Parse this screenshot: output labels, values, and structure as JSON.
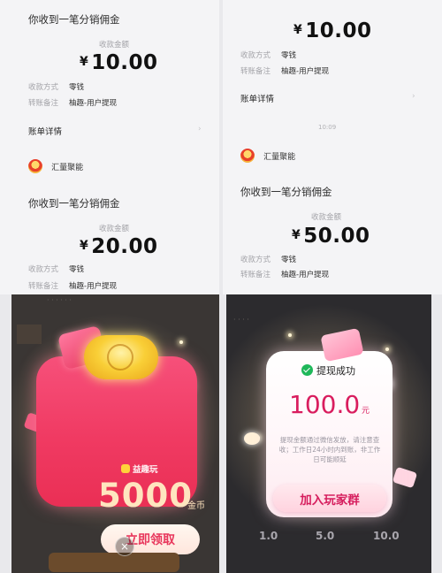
{
  "left_col": {
    "msg1": "你收到一笔分销佣金",
    "amount_label1": "收款金额",
    "amount1": "10.00",
    "method_label": "收款方式",
    "method_value": "零钱",
    "note_label": "转账备注",
    "note_value": "柚趣-用户提现",
    "bill_detail": "账单详情",
    "brand": "汇量聚能",
    "msg2": "你收到一笔分销佣金",
    "amount_label2": "收款金额",
    "amount2": "20.00"
  },
  "right_col": {
    "top_amount": "10.00",
    "method_label": "收款方式",
    "method_value": "零钱",
    "note_label": "转账备注",
    "note_value": "柚趣-用户提现",
    "bill_detail": "账单详情",
    "time": "10:09",
    "brand": "汇量聚能",
    "msg": "你收到一笔分销佣金",
    "amount_label": "收款金额",
    "amount": "50.00"
  },
  "currency_symbol": "¥",
  "coin_popup": {
    "brand": "益趣玩",
    "coins": "5000",
    "unit": "金币",
    "claim_button": "立即领取",
    "close": "×"
  },
  "cash_popup": {
    "title": "提现成功",
    "amount": "100.0",
    "unit": "元",
    "notice": "提现金额通过微信发放，请注意查收；工作日24小时内到账，非工作日可能顺延",
    "join_button": "加入玩家群",
    "options": [
      "1.0",
      "5.0",
      "10.0"
    ]
  },
  "colors": {
    "accent_red": "#f03a62",
    "cash_pink": "#d91d5e",
    "wechat_green": "#1fb85a"
  }
}
